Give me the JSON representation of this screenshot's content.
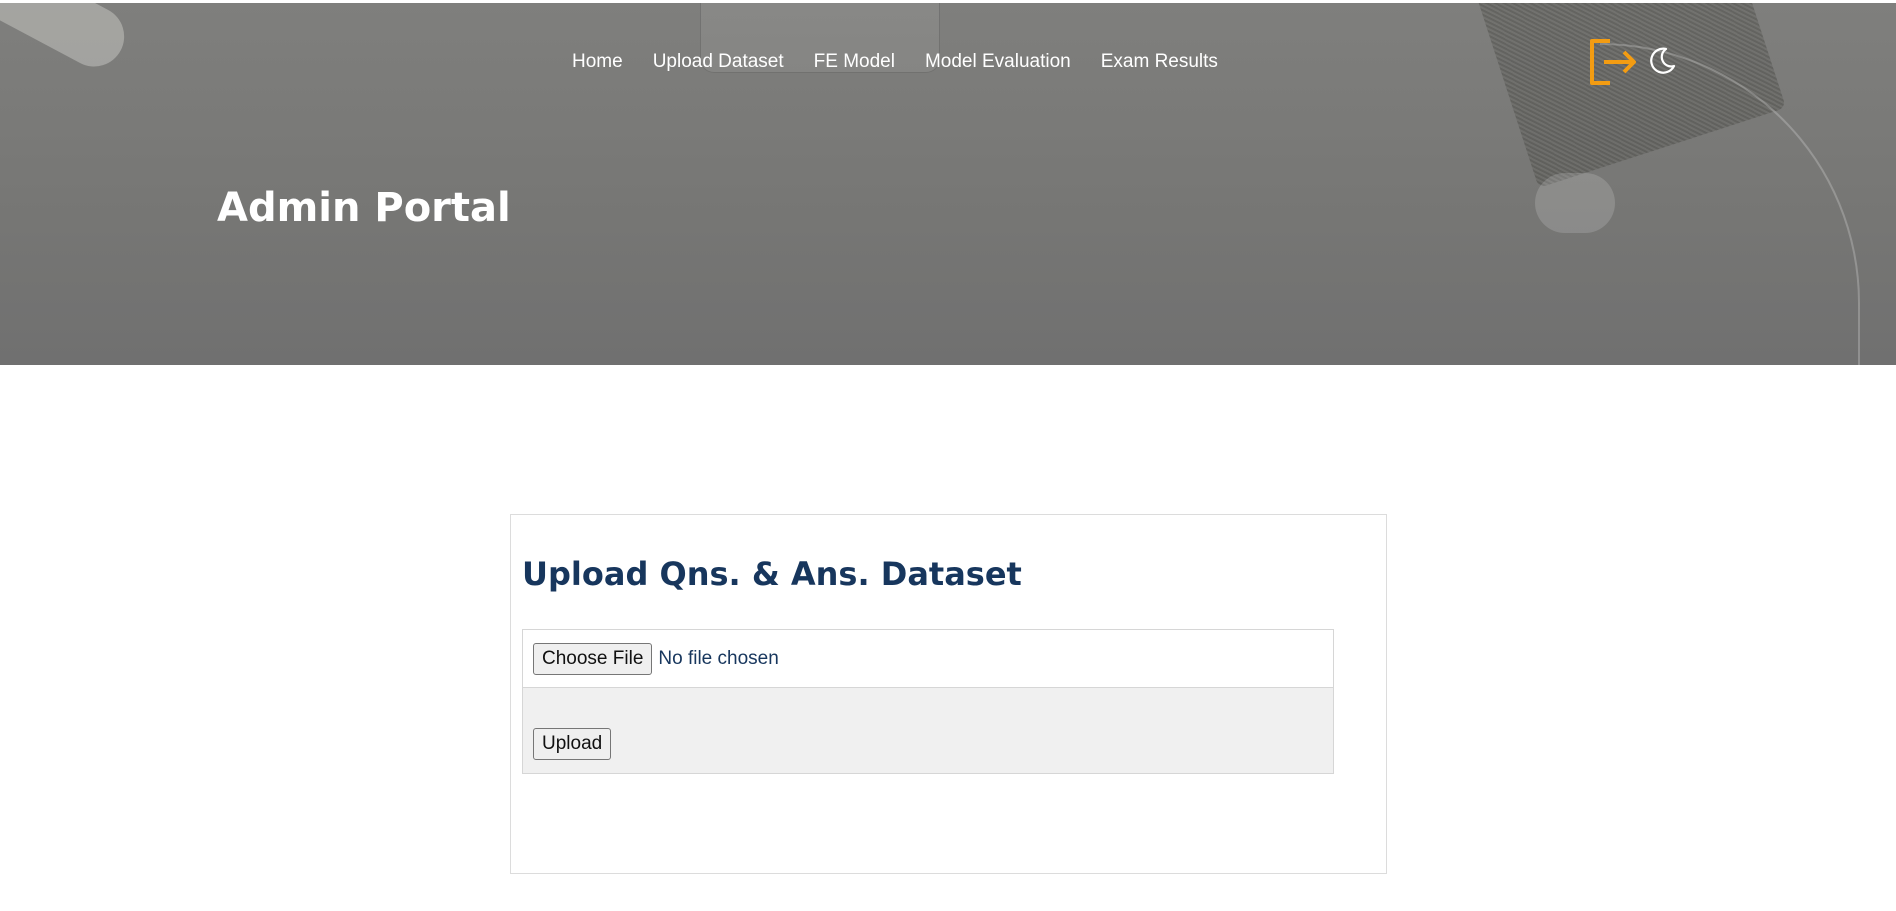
{
  "nav": {
    "items": [
      {
        "label": "Home"
      },
      {
        "label": "Upload Dataset"
      },
      {
        "label": "FE Model"
      },
      {
        "label": "Model Evaluation"
      },
      {
        "label": "Exam Results"
      }
    ]
  },
  "header": {
    "title": "Admin Portal",
    "icons": {
      "logout": "logout-icon",
      "theme": "moon-icon"
    },
    "logout_color": "#f39c12"
  },
  "upload": {
    "title": "Upload Qns. & Ans. Dataset",
    "choose_file_label": "Choose File",
    "file_status": "No file chosen",
    "upload_label": "Upload"
  },
  "colors": {
    "title_blue": "#17365d",
    "accent_orange": "#f39c12"
  }
}
